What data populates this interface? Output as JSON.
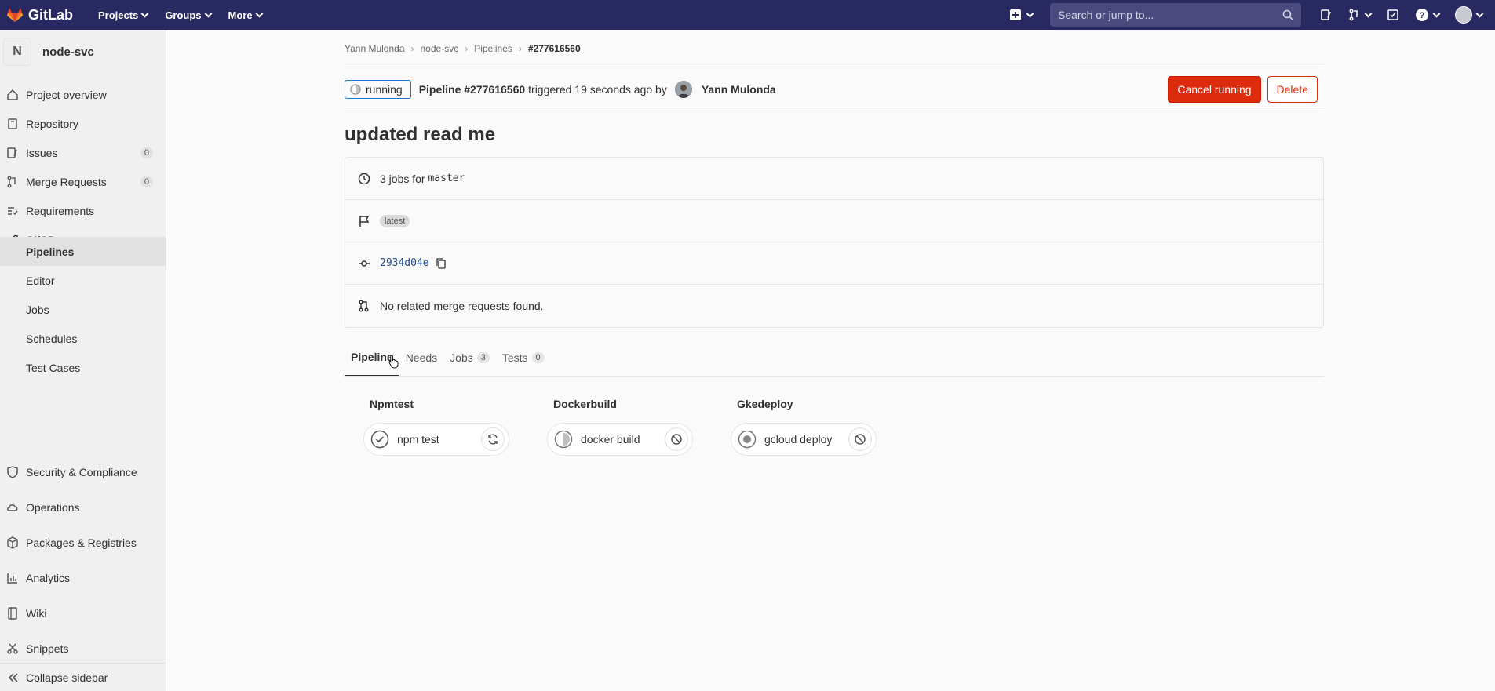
{
  "navbar": {
    "logo_text": "GitLab",
    "menu": [
      "Projects",
      "Groups",
      "More"
    ],
    "search_placeholder": "Search or jump to..."
  },
  "sidebar": {
    "project_initial": "N",
    "project_name": "node-svc",
    "items": [
      {
        "label": "Project overview"
      },
      {
        "label": "Repository"
      },
      {
        "label": "Issues",
        "badge": "0"
      },
      {
        "label": "Merge Requests",
        "badge": "0"
      },
      {
        "label": "Requirements"
      },
      {
        "label": "CI/CD"
      },
      {
        "label": "Security & Compliance"
      },
      {
        "label": "Operations"
      },
      {
        "label": "Packages & Registries"
      },
      {
        "label": "Analytics"
      },
      {
        "label": "Wiki"
      },
      {
        "label": "Snippets"
      }
    ],
    "cicd_sub": [
      "Pipelines",
      "Editor",
      "Jobs",
      "Schedules",
      "Test Cases"
    ],
    "collapse_label": "Collapse sidebar"
  },
  "breadcrumb": [
    "Yann Mulonda",
    "node-svc",
    "Pipelines",
    "#277616560"
  ],
  "header": {
    "status": "running",
    "pipeline": "Pipeline #277616560",
    "triggered": "triggered 19 seconds ago by",
    "author": "Yann Mulonda",
    "cancel_label": "Cancel running",
    "delete_label": "Delete"
  },
  "title": "updated read me",
  "info": {
    "jobs_text": "3 jobs for",
    "branch": "master",
    "latest": "latest",
    "sha": "2934d04e",
    "mr_text": "No related merge requests found."
  },
  "tabs": [
    {
      "label": "Pipeline"
    },
    {
      "label": "Needs"
    },
    {
      "label": "Jobs",
      "count": "3"
    },
    {
      "label": "Tests",
      "count": "0"
    }
  ],
  "stages": [
    {
      "title": "Npmtest",
      "job": "npm test",
      "status": "passed"
    },
    {
      "title": "Dockerbuild",
      "job": "docker build",
      "status": "running"
    },
    {
      "title": "Gkedeploy",
      "job": "gcloud deploy",
      "status": "pending"
    }
  ],
  "colors": {
    "navbar": "#292961",
    "danger": "#dd2b0e",
    "running": "#1f78d1"
  }
}
